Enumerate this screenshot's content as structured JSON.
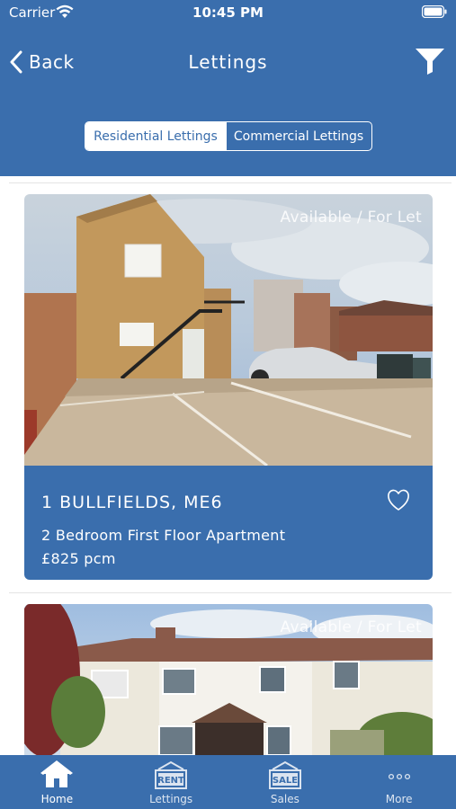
{
  "status_bar": {
    "carrier": "Carrier",
    "time": "10:45 PM"
  },
  "nav": {
    "back_label": "Back",
    "title": "Lettings"
  },
  "segments": {
    "residential": "Residential Lettings",
    "commercial": "Commercial Lettings",
    "selected": "Residential Lettings"
  },
  "listings": [
    {
      "status": "Available / For Let",
      "address": "1 BULLFIELDS, ME6",
      "description": "2 Bedroom First Floor Apartment",
      "price": "£825 pcm"
    },
    {
      "status": "Available / For Let"
    }
  ],
  "tabs": [
    {
      "label": "Home",
      "icon": "house-icon"
    },
    {
      "label": "Lettings",
      "icon": "rent-sign-icon",
      "badge": "RENT"
    },
    {
      "label": "Sales",
      "icon": "sale-sign-icon",
      "badge": "SALE"
    },
    {
      "label": "More",
      "icon": "more-dots-icon"
    }
  ],
  "colors": {
    "brand": "#3A6EAD",
    "background": "#ffffff"
  }
}
